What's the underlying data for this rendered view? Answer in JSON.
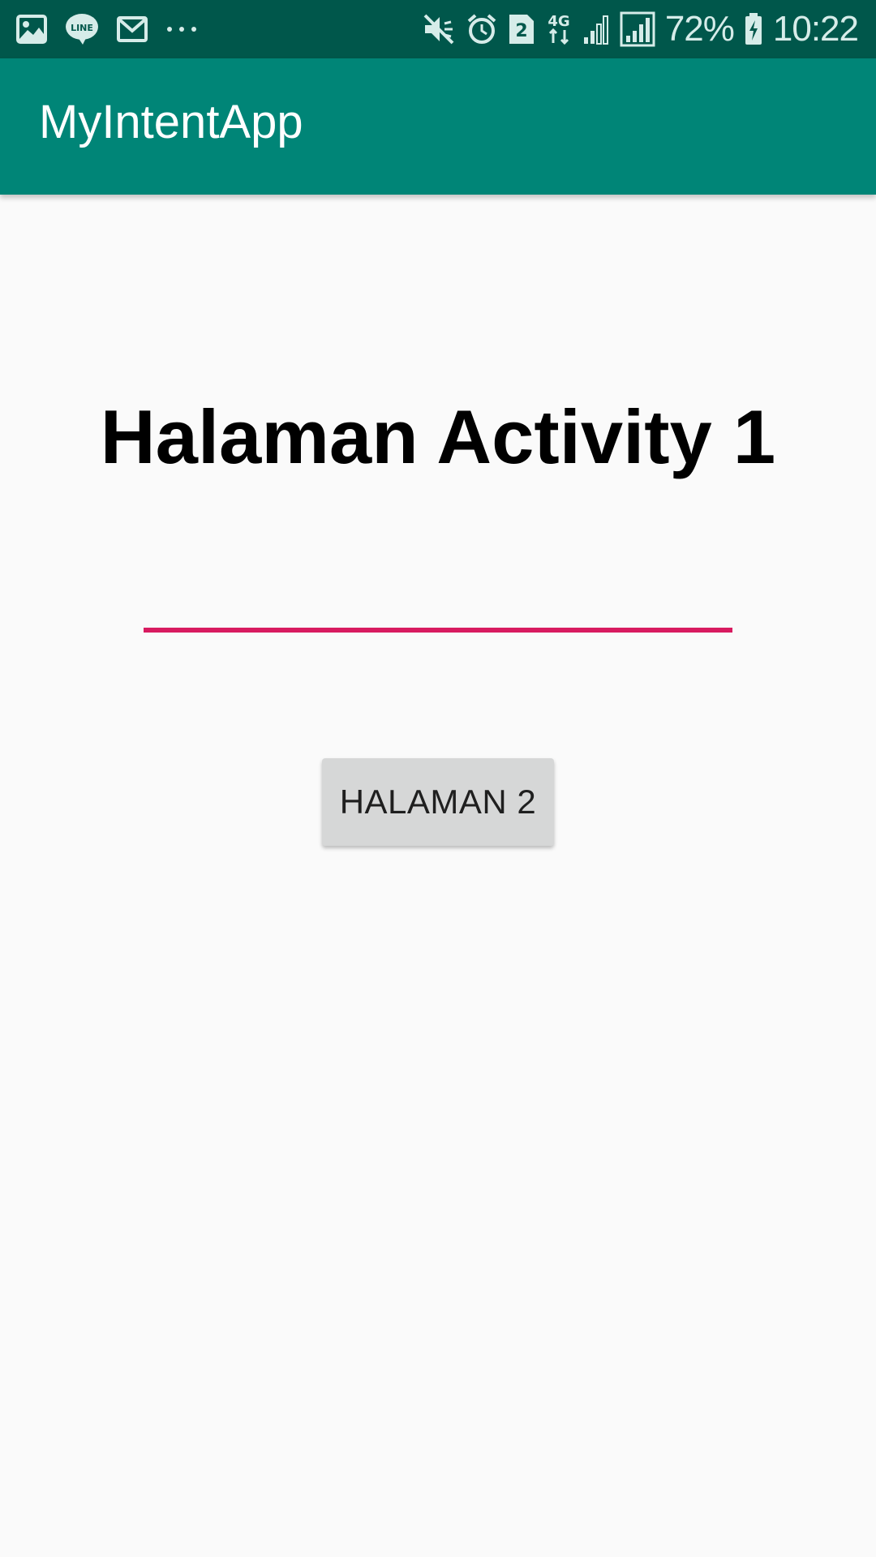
{
  "status_bar": {
    "icons_left": [
      "image-icon",
      "line-app-icon",
      "gmail-icon",
      "more-dots-icon"
    ],
    "icons_right": [
      "mute-vibrate-icon",
      "alarm-icon",
      "sim-2-icon",
      "4g-data-icon",
      "signal-weak-icon",
      "signal-icon"
    ],
    "sim_badge": "2",
    "network_label": "4G",
    "battery_percent": "72%",
    "time": "10:22",
    "colors": {
      "background": "#00574b",
      "icon": "#d6ece9"
    }
  },
  "toolbar": {
    "title": "MyIntentApp",
    "color": "#008577"
  },
  "main": {
    "heading": "Halaman Activity 1",
    "input": {
      "value": "",
      "underline_color": "#d81b60"
    },
    "button_label": "HALAMAN 2"
  }
}
